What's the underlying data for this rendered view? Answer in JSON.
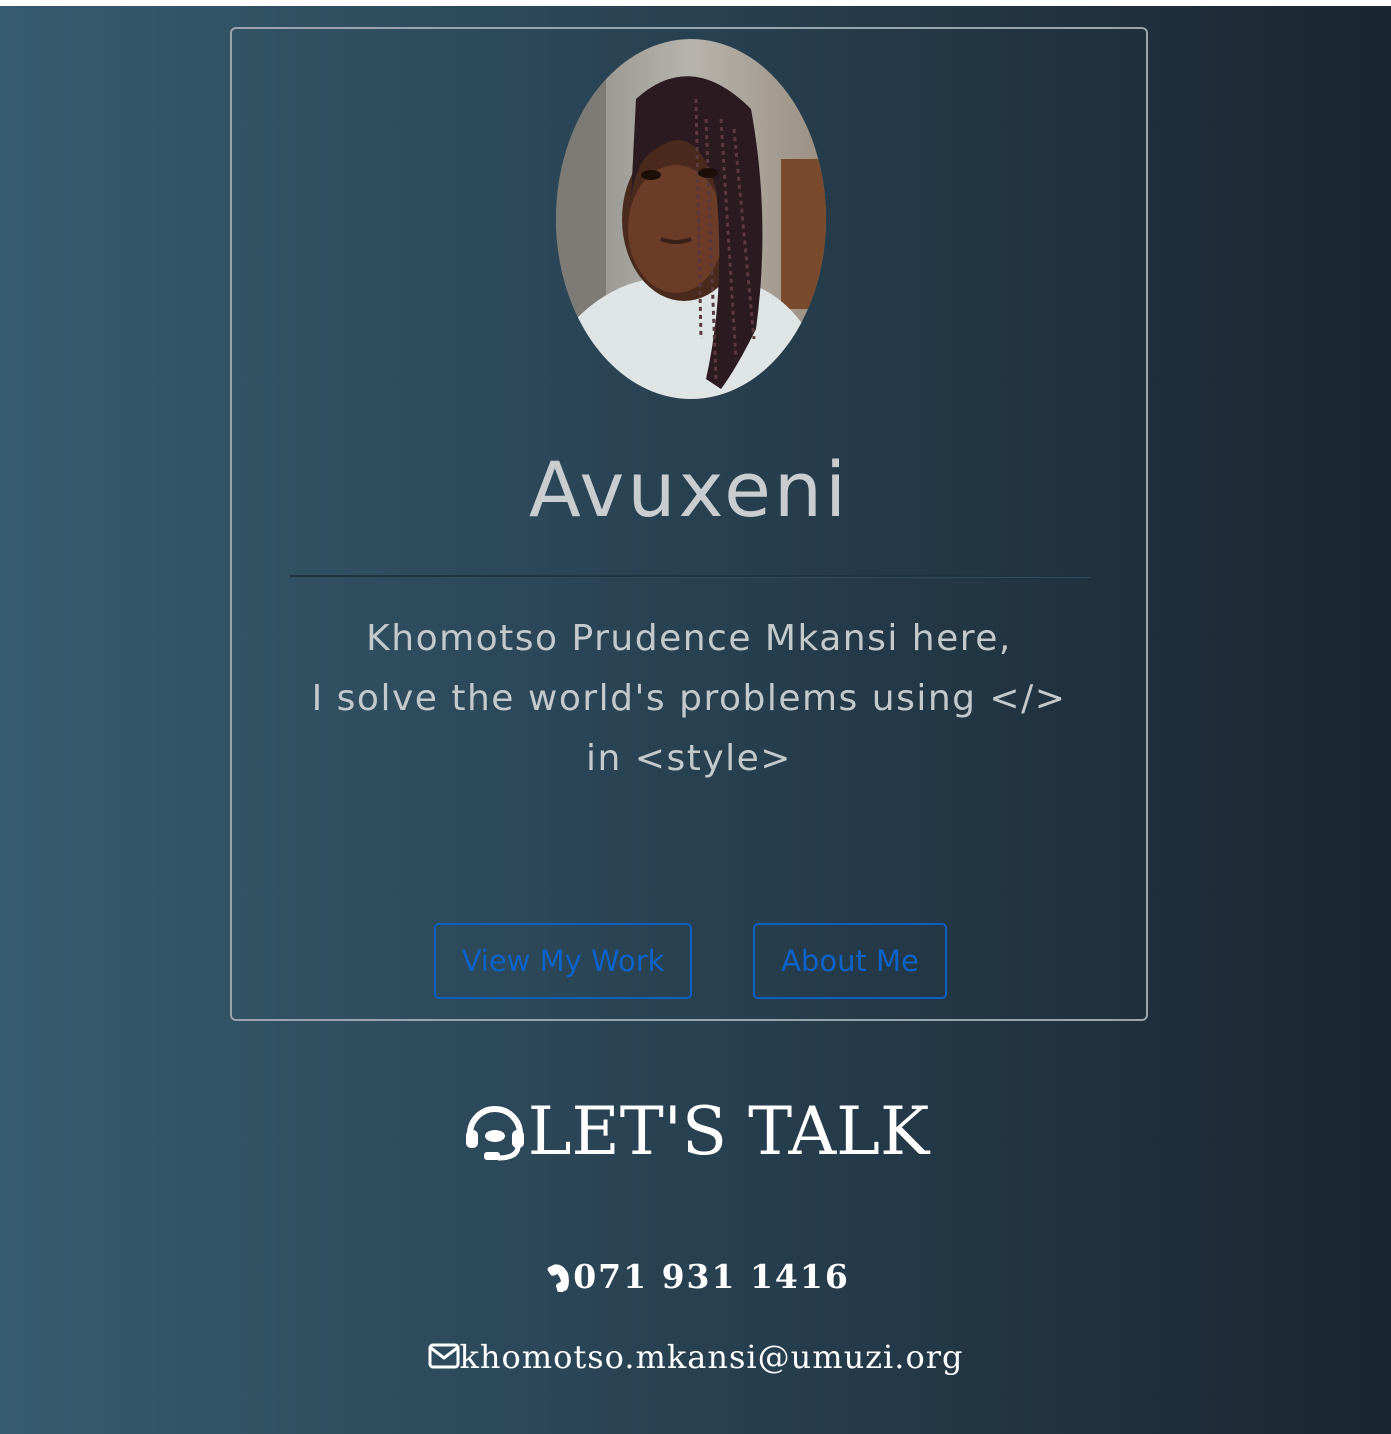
{
  "profile": {
    "name": "Avuxeni",
    "bio_lines": [
      "Khomotso Prudence Mkansi here,",
      "I solve the world's problems using </>",
      "in <style>"
    ]
  },
  "buttons": {
    "view_work": "View My Work",
    "about_me": "About Me"
  },
  "contact": {
    "heading": "LET'S TALK",
    "phone": "071 931 1416",
    "email": "khomotso.mkansi@umuzi.org"
  },
  "icons": {
    "heading_icon": "headset-icon",
    "phone_icon": "phone-icon",
    "email_icon": "envelope-icon"
  },
  "colors": {
    "button_accent": "#0d63c9",
    "background_left": "#375b6e",
    "background_right": "#1a2630",
    "text_light": "#c9cdd0"
  }
}
